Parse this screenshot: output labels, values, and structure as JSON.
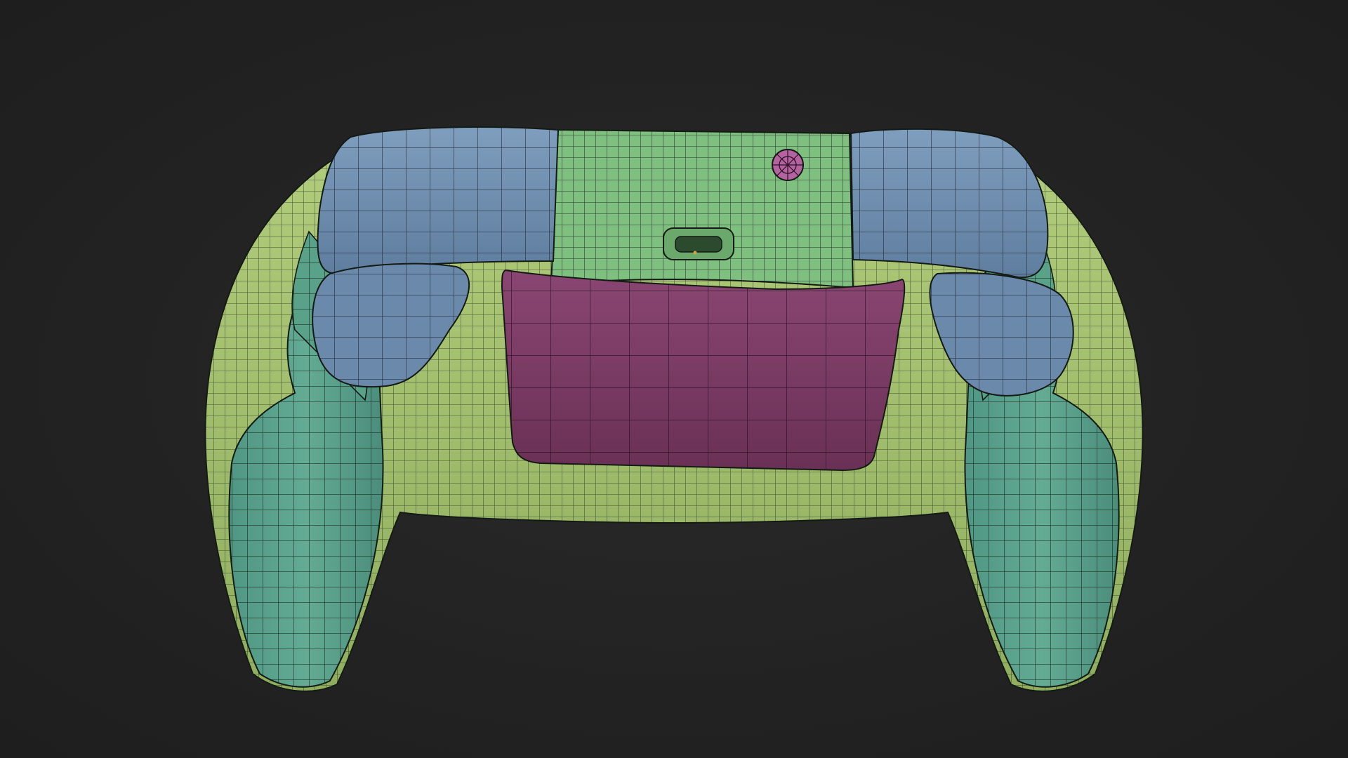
{
  "scene": {
    "subject": "gamepad-controller-wireframe",
    "background_color": "#232323",
    "wire_color": "#141a14",
    "parts": [
      {
        "name": "left-grip",
        "color": "#5fa58e"
      },
      {
        "name": "right-grip",
        "color": "#5fa58e"
      },
      {
        "name": "left-bumper",
        "color": "#6f8fb0"
      },
      {
        "name": "right-bumper",
        "color": "#6f8fb0"
      },
      {
        "name": "left-trigger",
        "color": "#6a89ab"
      },
      {
        "name": "right-trigger",
        "color": "#6a89ab"
      },
      {
        "name": "body-shell",
        "color": "#a6c46e"
      },
      {
        "name": "top-panel",
        "color": "#7fbf80"
      },
      {
        "name": "back-battery-door",
        "color": "#7a3a63"
      },
      {
        "name": "pair-button",
        "color": "#b462a0"
      },
      {
        "name": "usb-port",
        "color": "#5f9e63"
      }
    ]
  }
}
